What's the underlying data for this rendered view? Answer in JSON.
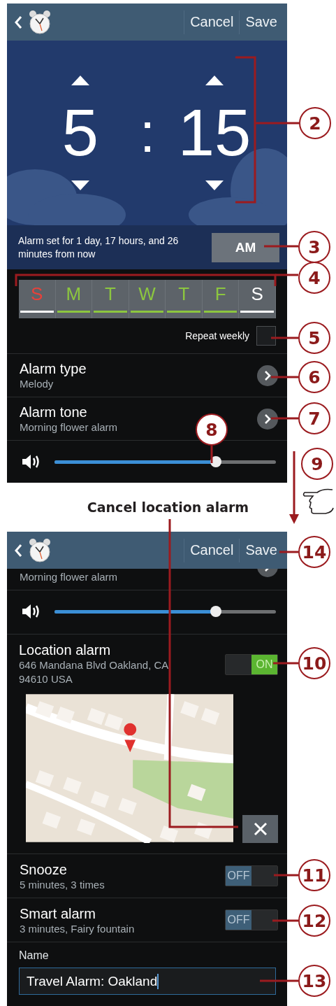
{
  "screen_1": {
    "header": {
      "cancel": "Cancel",
      "save": "Save"
    },
    "time": {
      "hour": "5",
      "separator": ":",
      "minute": "15"
    },
    "info": {
      "text": "Alarm set for 1 day, 17 hours, and 26 minutes from now",
      "ampm": "AM"
    },
    "days": [
      {
        "label": "S",
        "selected": false,
        "color": "#e8413a"
      },
      {
        "label": "M",
        "selected": true,
        "color": "#8cc63f"
      },
      {
        "label": "T",
        "selected": true,
        "color": "#8cc63f"
      },
      {
        "label": "W",
        "selected": true,
        "color": "#8cc63f"
      },
      {
        "label": "T",
        "selected": true,
        "color": "#8cc63f"
      },
      {
        "label": "F",
        "selected": true,
        "color": "#8cc63f"
      },
      {
        "label": "S",
        "selected": false,
        "color": "#ffffff"
      }
    ],
    "repeat": {
      "label": "Repeat weekly",
      "checked": false
    },
    "settings": [
      {
        "title": "Alarm type",
        "value": "Melody"
      },
      {
        "title": "Alarm tone",
        "value": "Morning flower alarm"
      }
    ],
    "volume": {
      "level": 0.73
    }
  },
  "caption": "Cancel location alarm",
  "screen_2": {
    "header": {
      "cancel": "Cancel",
      "save": "Save"
    },
    "partial_value": "Morning flower alarm",
    "volume": {
      "level": 0.73
    },
    "location": {
      "title": "Location alarm",
      "address": "646 Mandana Blvd Oakland, CA 94610 USA",
      "on": true,
      "toggle_label": "ON"
    },
    "toggles": [
      {
        "title": "Snooze",
        "value": "5 minutes, 3 times",
        "on": false,
        "toggle_label": "OFF"
      },
      {
        "title": "Smart alarm",
        "value": "3 minutes, Fairy fountain",
        "on": false,
        "toggle_label": "OFF"
      }
    ],
    "name": {
      "label": "Name",
      "value": "Travel Alarm: Oakland"
    }
  },
  "callouts": [
    "2",
    "3",
    "4",
    "5",
    "6",
    "7",
    "8",
    "9",
    "14",
    "10",
    "11",
    "12",
    "13"
  ]
}
